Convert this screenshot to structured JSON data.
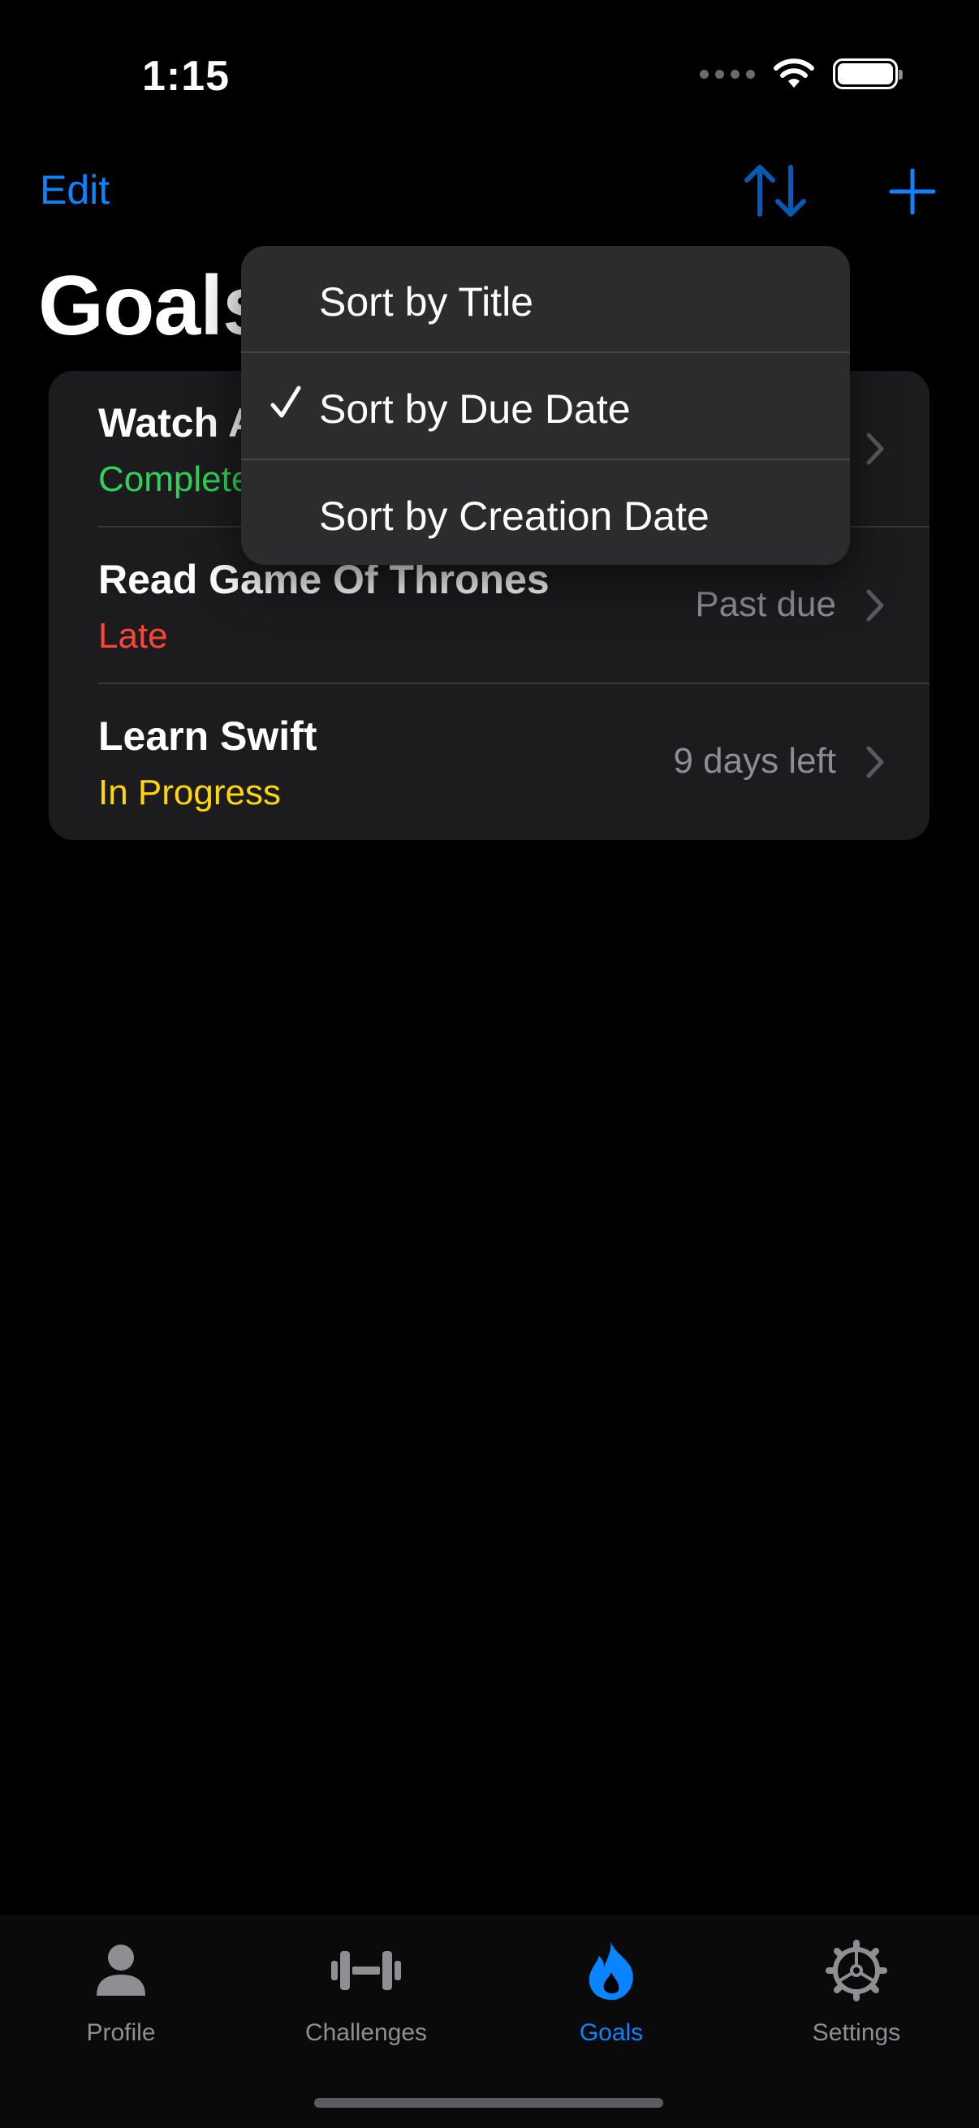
{
  "status_bar": {
    "time": "1:15"
  },
  "nav": {
    "edit_label": "Edit",
    "title": "Goals"
  },
  "goals": [
    {
      "title": "Watch A",
      "status": "Complete",
      "status_color": "#30d158",
      "due": ""
    },
    {
      "title": "Read Game Of Thrones",
      "status": "Late",
      "status_color": "#ff453a",
      "due": "Past due"
    },
    {
      "title": "Learn Swift",
      "status": "In Progress",
      "status_color": "#ffd60a",
      "due": "9 days left"
    }
  ],
  "sort_menu": {
    "items": [
      {
        "label": "Sort by Title",
        "checked": false
      },
      {
        "label": "Sort by Due Date",
        "checked": true
      },
      {
        "label": "Sort by Creation Date",
        "checked": false
      }
    ]
  },
  "tabs": [
    {
      "label": "Profile",
      "icon": "person-icon",
      "active": false
    },
    {
      "label": "Challenges",
      "icon": "dumbbell-icon",
      "active": false
    },
    {
      "label": "Goals",
      "icon": "flame-icon",
      "active": true
    },
    {
      "label": "Settings",
      "icon": "gear-icon",
      "active": false
    }
  ],
  "colors": {
    "accent": "#0a84ff",
    "background": "#000000",
    "card": "#1c1c1e",
    "menu": "#2c2c2e"
  }
}
